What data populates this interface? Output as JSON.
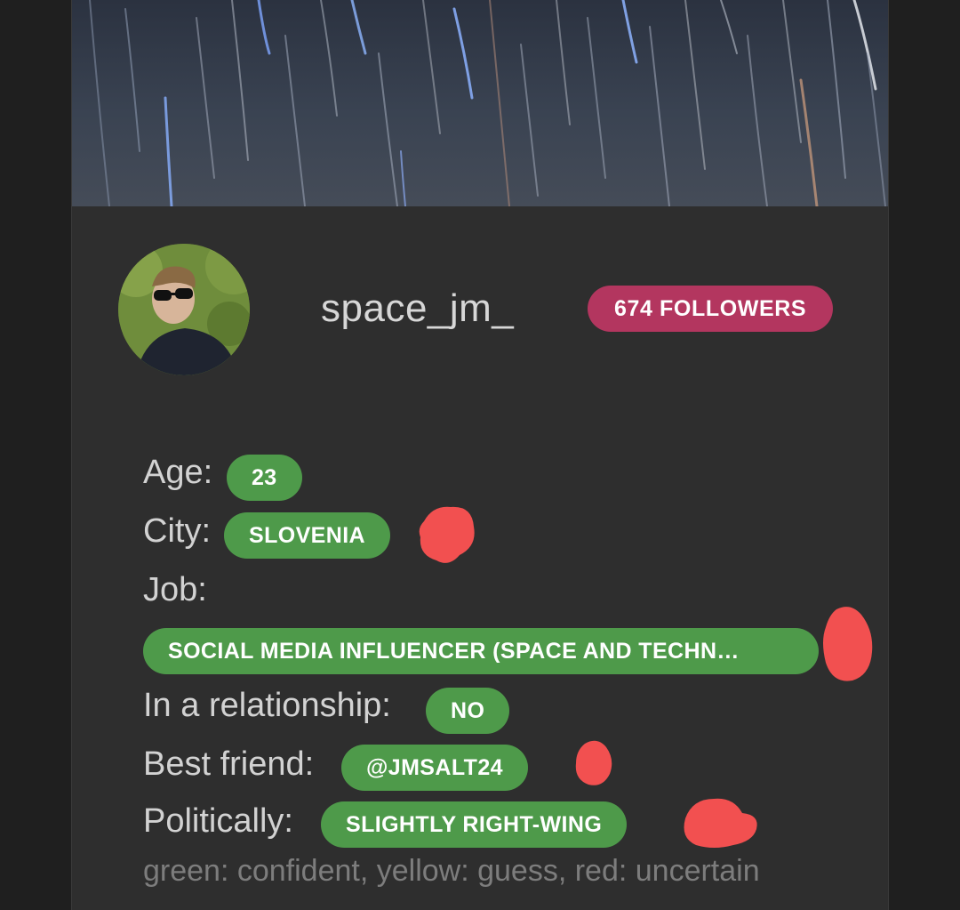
{
  "profile": {
    "username": "space_jm_",
    "followers": "674 FOLLOWERS"
  },
  "fields": {
    "age": {
      "label": "Age:",
      "value": "23"
    },
    "city": {
      "label": "City:",
      "value": "SLOVENIA"
    },
    "job": {
      "label": "Job:",
      "value": "SOCIAL MEDIA INFLUENCER (SPACE AND TECHN…"
    },
    "relationship": {
      "label": "In a relationship:",
      "value": "NO"
    },
    "best_friend": {
      "label": "Best friend:",
      "value": "@JMSALT24"
    },
    "political": {
      "label": "Politically:",
      "value": "SLIGHTLY RIGHT-WING"
    }
  },
  "legend": "green: confident, yellow: guess, red: uncertain",
  "colors": {
    "chip_green": "#4e9a4a",
    "followers_pink": "#b3365f",
    "annotation_red": "#f25050"
  }
}
